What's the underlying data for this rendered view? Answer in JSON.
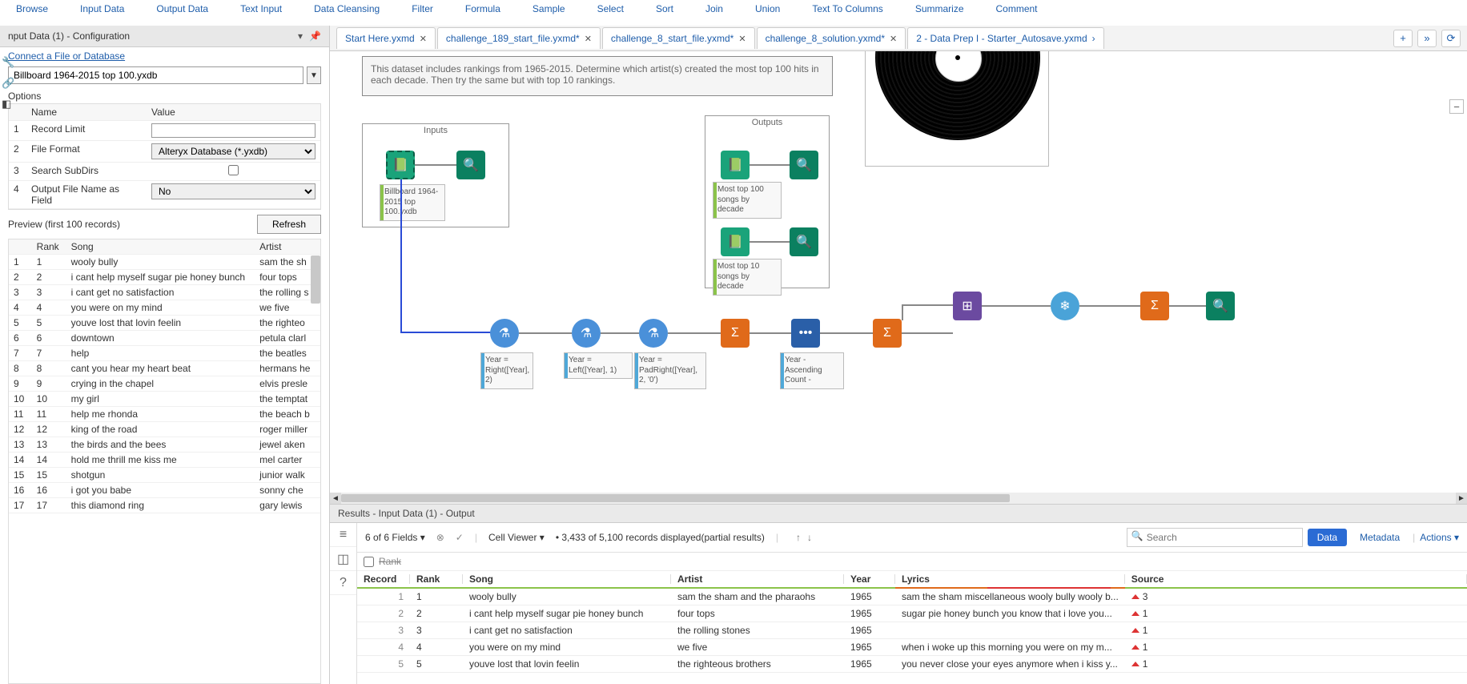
{
  "toolbar": [
    "Browse",
    "Input Data",
    "Output Data",
    "Text Input",
    "Data Cleansing",
    "Filter",
    "Formula",
    "Sample",
    "Select",
    "Sort",
    "Join",
    "Union",
    "Text To Columns",
    "Summarize",
    "Comment"
  ],
  "config": {
    "title": "nput Data (1) - Configuration",
    "connect": "Connect a File or Database",
    "file": "Billboard 1964-2015 top 100.yxdb",
    "options_label": "Options",
    "headers": {
      "name": "Name",
      "value": "Value"
    },
    "rows": [
      {
        "n": "1",
        "name": "Record Limit",
        "value": ""
      },
      {
        "n": "2",
        "name": "File Format",
        "value": "Alteryx Database (*.yxdb)"
      },
      {
        "n": "3",
        "name": "Search SubDirs",
        "value": ""
      },
      {
        "n": "4",
        "name": "Output File Name as Field",
        "value": "No"
      }
    ],
    "preview_label": "Preview (first 100 records)",
    "refresh": "Refresh",
    "preview_headers": [
      "",
      "Rank",
      "Song",
      "Artist"
    ],
    "preview": [
      {
        "i": "1",
        "rank": "1",
        "song": "wooly bully",
        "artist": "sam the sh"
      },
      {
        "i": "2",
        "rank": "2",
        "song": "i cant help myself sugar pie honey bunch",
        "artist": "four tops"
      },
      {
        "i": "3",
        "rank": "3",
        "song": "i cant get no satisfaction",
        "artist": "the rolling s"
      },
      {
        "i": "4",
        "rank": "4",
        "song": "you were on my mind",
        "artist": "we five"
      },
      {
        "i": "5",
        "rank": "5",
        "song": "youve lost that lovin feelin",
        "artist": "the righteo"
      },
      {
        "i": "6",
        "rank": "6",
        "song": "downtown",
        "artist": "petula clarl"
      },
      {
        "i": "7",
        "rank": "7",
        "song": "help",
        "artist": "the beatles"
      },
      {
        "i": "8",
        "rank": "8",
        "song": "cant you hear my heart beat",
        "artist": "hermans he"
      },
      {
        "i": "9",
        "rank": "9",
        "song": "crying in the chapel",
        "artist": "elvis presle"
      },
      {
        "i": "10",
        "rank": "10",
        "song": "my girl",
        "artist": "the temptat"
      },
      {
        "i": "11",
        "rank": "11",
        "song": "help me rhonda",
        "artist": "the beach b"
      },
      {
        "i": "12",
        "rank": "12",
        "song": "king of the road",
        "artist": "roger miller"
      },
      {
        "i": "13",
        "rank": "13",
        "song": "the birds and the bees",
        "artist": "jewel aken"
      },
      {
        "i": "14",
        "rank": "14",
        "song": "hold me thrill me kiss me",
        "artist": "mel carter"
      },
      {
        "i": "15",
        "rank": "15",
        "song": "shotgun",
        "artist": "junior walk"
      },
      {
        "i": "16",
        "rank": "16",
        "song": "i got you babe",
        "artist": "sonny   che"
      },
      {
        "i": "17",
        "rank": "17",
        "song": "this diamond ring",
        "artist": "gary lewis"
      }
    ]
  },
  "tabs": [
    {
      "label": "Start Here.yxmd",
      "close": true
    },
    {
      "label": "challenge_189_start_file.yxmd*",
      "close": true
    },
    {
      "label": "challenge_8_start_file.yxmd*",
      "close": true
    },
    {
      "label": "challenge_8_solution.yxmd*",
      "close": true
    },
    {
      "label": "2 - Data Prep I - Starter_Autosave.yxmd",
      "close": false
    }
  ],
  "canvas": {
    "comment": "This dataset includes rankings from 1965-2015. Determine which artist(s) created the most top 100 hits in each decade. Then try the same but with top 10 rankings.",
    "inputs_label": "Inputs",
    "outputs_label": "Outputs",
    "input_anno": "Billboard 1964-2015 top 100.yxdb",
    "out1": "Most top 100 songs by decade",
    "out2": "Most top 10 songs by decade",
    "formula1": "Year = Right([Year], 2)",
    "formula2": "Year = Left([Year], 1)",
    "formula3": "Year = PadRight([Year], 2, '0')",
    "sort1": "Year - Ascending\nCount -"
  },
  "results": {
    "title": "Results - Input Data (1) - Output",
    "fields": "6 of 6 Fields",
    "cellviewer": "Cell Viewer",
    "records": "3,433 of 5,100 records displayed(partial results)",
    "search_placeholder": "Search",
    "data": "Data",
    "metadata": "Metadata",
    "actions": "Actions",
    "filter_stub": "Rank",
    "headers": [
      "Record",
      "Rank",
      "Song",
      "Artist",
      "Year",
      "Lyrics",
      "Source"
    ],
    "rows": [
      {
        "rec": "1",
        "rank": "1",
        "song": "wooly bully",
        "artist": "sam the sham and the pharaohs",
        "year": "1965",
        "lyrics": "sam the sham miscellaneous wooly bully wooly b...",
        "src": "3"
      },
      {
        "rec": "2",
        "rank": "2",
        "song": "i cant help myself sugar pie honey bunch",
        "artist": "four tops",
        "year": "1965",
        "lyrics": "sugar pie honey bunch you know that i love you...",
        "src": "1"
      },
      {
        "rec": "3",
        "rank": "3",
        "song": "i cant get no satisfaction",
        "artist": "the rolling stones",
        "year": "1965",
        "lyrics": "",
        "src": "1"
      },
      {
        "rec": "4",
        "rank": "4",
        "song": "you were on my mind",
        "artist": "we five",
        "year": "1965",
        "lyrics": "when i woke up this morning you were on my m...",
        "src": "1"
      },
      {
        "rec": "5",
        "rank": "5",
        "song": "youve lost that lovin feelin",
        "artist": "the righteous brothers",
        "year": "1965",
        "lyrics": "you never close your eyes anymore when i kiss y...",
        "src": "1"
      }
    ]
  }
}
